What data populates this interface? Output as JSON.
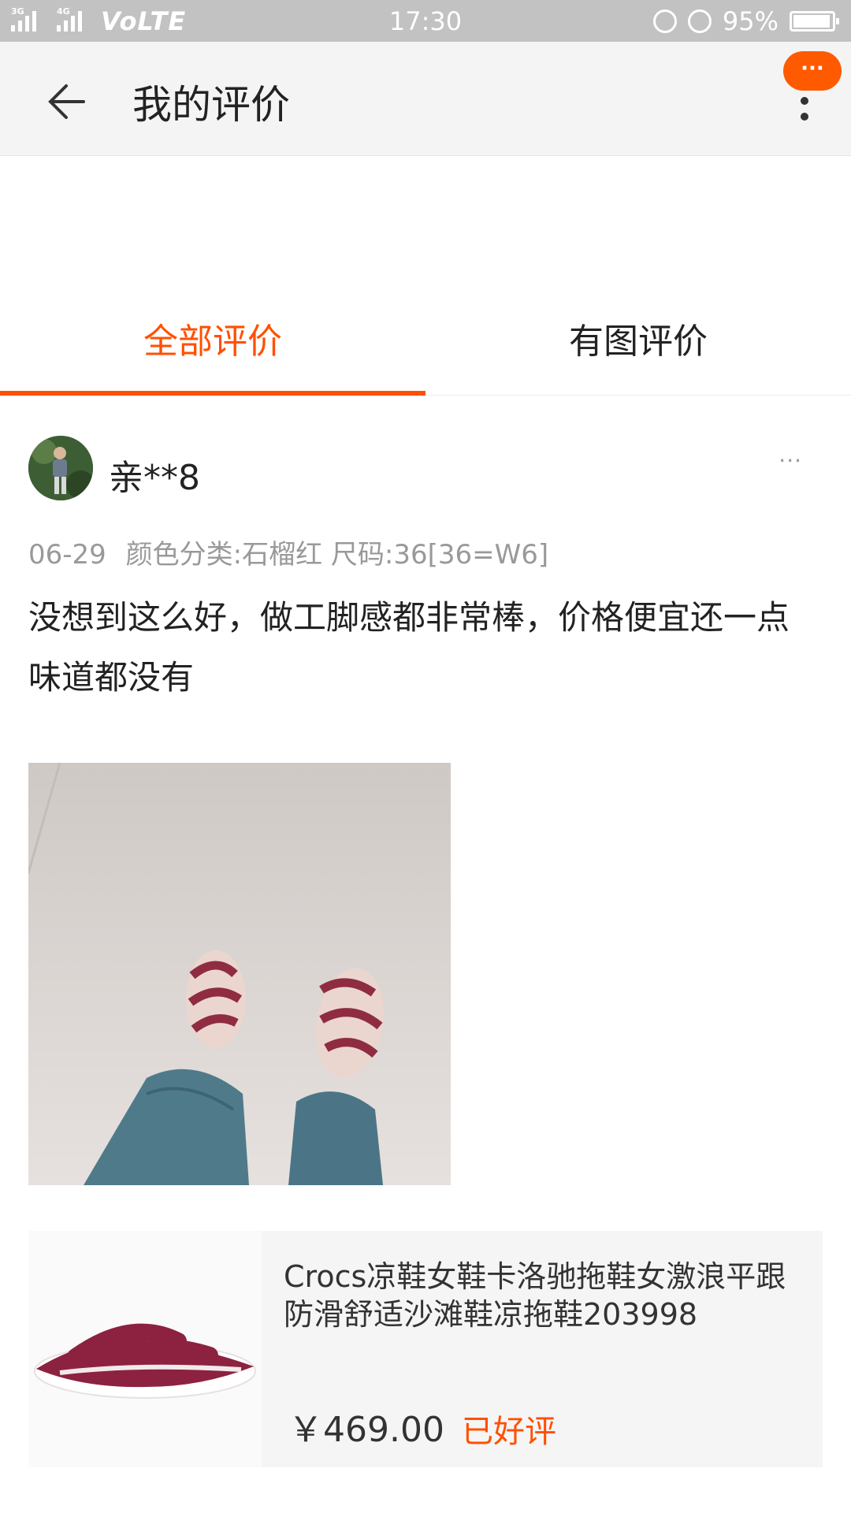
{
  "status_bar": {
    "network_a": "3G",
    "network_b": "4G",
    "volte": "VoLTE",
    "time": "17:30",
    "battery": "95%"
  },
  "header": {
    "title": "我的评价",
    "badge": "···"
  },
  "tabs": [
    {
      "label": "全部评价",
      "active": true
    },
    {
      "label": "有图评价",
      "active": false
    }
  ],
  "review": {
    "username": "亲**8",
    "more": "···",
    "date": "06-29",
    "sku": "颜色分类:石榴红 尺码:36[36=W6]",
    "text": "没想到这么好，做工脚感都非常棒，价格便宜还一点味道都没有"
  },
  "product": {
    "title": "Crocs凉鞋女鞋卡洛驰拖鞋女激浪平跟防滑舒适沙滩鞋凉拖鞋203998",
    "price": "￥469.00",
    "status": "已好评"
  },
  "colors": {
    "accent": "#ff5000",
    "header_bg": "#f4f4f4",
    "status_bar_bg": "#c2c2c2"
  }
}
